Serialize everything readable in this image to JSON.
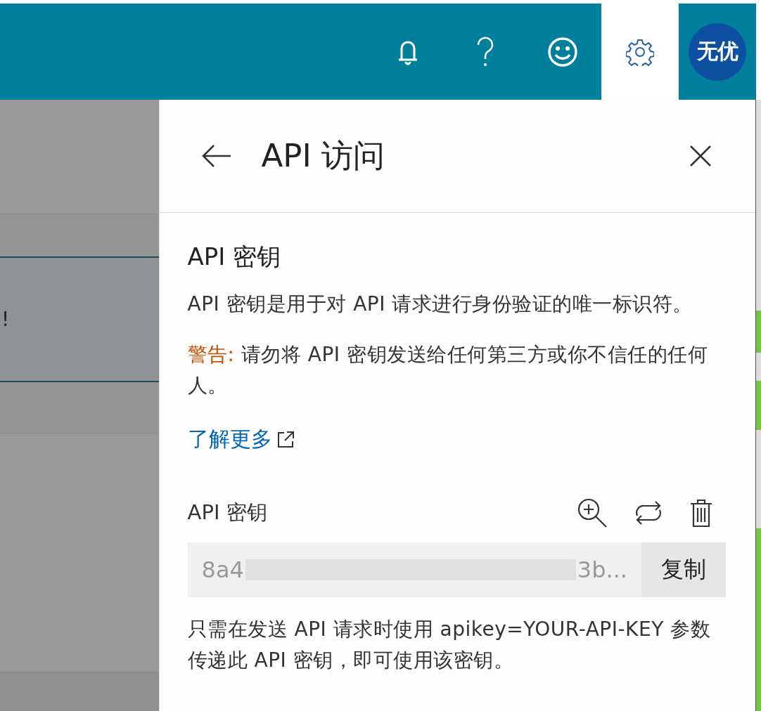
{
  "topbar": {
    "icons": [
      {
        "kind": "bell",
        "selected": false
      },
      {
        "kind": "help",
        "selected": false
      },
      {
        "kind": "smiley",
        "selected": false
      },
      {
        "kind": "gear",
        "selected": true
      }
    ],
    "avatar": "无优"
  },
  "background": {
    "banner_text": "!"
  },
  "panel": {
    "title": "API 访问",
    "section_title": "API 密钥",
    "description": "API 密钥是用于对 API 请求进行身份验证的唯一标识符。",
    "warning_label": "警告:",
    "warning_text": " 请勿将 API 密钥发送给任何第三方或你不信任的任何人。",
    "link": "了解更多",
    "key_label": "API 密钥",
    "key_actions": [
      {
        "kind": "view"
      },
      {
        "kind": "regenerate"
      },
      {
        "kind": "delete"
      }
    ],
    "key_start": "8a4",
    "key_end": "3b...",
    "copy_button": "复制",
    "usage": "只需在发送 API 请求时使用 apikey=YOUR-API-KEY 参数传递此 API 密钥，即可使用该密钥。"
  }
}
